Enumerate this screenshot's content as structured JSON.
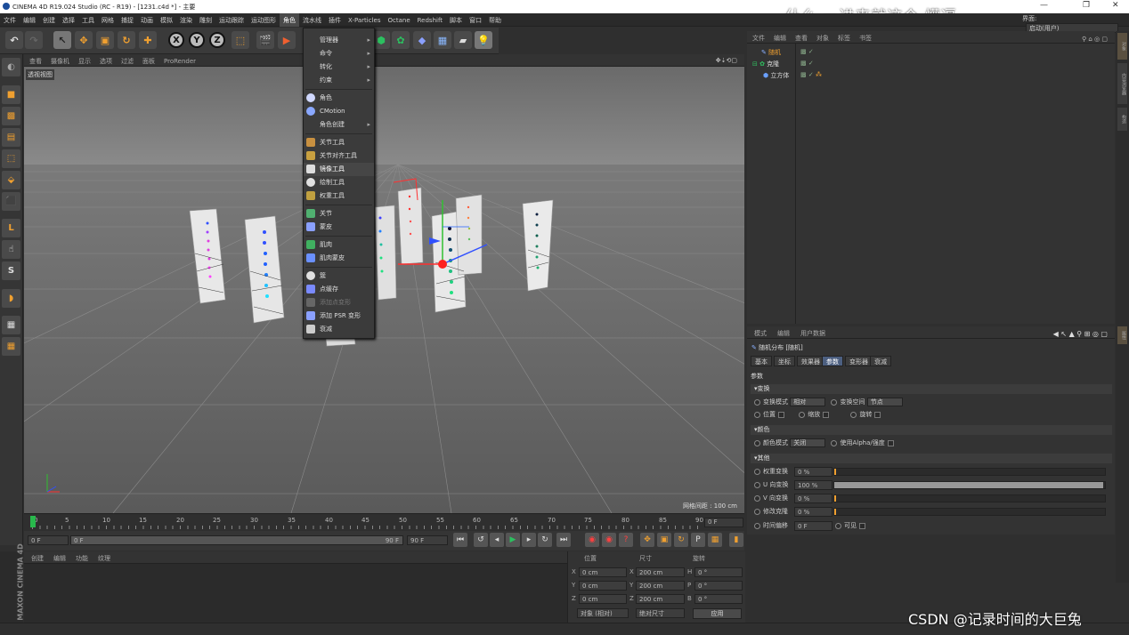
{
  "window": {
    "title": "CINEMA 4D R19.024 Studio (RC - R19) - [1231.c4d *] - 主要",
    "minimize": "—",
    "maximize": "❐",
    "close": "✕"
  },
  "overlay_text": "什么   一进来就这个  懵逼",
  "watermark": "CSDN @记录时间的大巨兔",
  "layout": {
    "label": "界面:",
    "value": "启动(用户)"
  },
  "menubar": [
    "文件",
    "编辑",
    "创建",
    "选择",
    "工具",
    "网格",
    "捕捉",
    "动画",
    "模拟",
    "渲染",
    "雕刻",
    "运动跟踪",
    "运动图形",
    "角色",
    "流水线",
    "插件",
    "X-Particles",
    "Octane",
    "Redshift",
    "脚本",
    "窗口",
    "帮助"
  ],
  "active_menu": "角色",
  "dropdown": {
    "items": [
      {
        "label": "管理器",
        "submenu": true
      },
      {
        "label": "命令",
        "submenu": true
      },
      {
        "label": "转化",
        "submenu": true
      },
      {
        "label": "约束",
        "submenu": true
      },
      {
        "label": "角色"
      },
      {
        "label": "CMotion"
      },
      {
        "label": "角色创建",
        "submenu": true
      },
      {
        "label": "关节工具"
      },
      {
        "label": "关节对齐工具"
      },
      {
        "label": "镜像工具"
      },
      {
        "label": "绘制工具"
      },
      {
        "label": "权重工具"
      },
      {
        "label": "关节"
      },
      {
        "label": "蒙皮"
      },
      {
        "label": "肌肉"
      },
      {
        "label": "肌肉蒙皮"
      },
      {
        "label": "簇"
      },
      {
        "label": "点缓存"
      },
      {
        "label": "添加点变形"
      },
      {
        "label": "添加 PSR 变形"
      },
      {
        "label": "衰减"
      }
    ]
  },
  "viewport": {
    "menu": [
      "查看",
      "摄像机",
      "显示",
      "选项",
      "过滤",
      "面板",
      "ProRender"
    ],
    "label": "透视视图",
    "grid_spacing": "网格间距 : 100 cm"
  },
  "timeline": {
    "ticks": [
      "0",
      "5",
      "10",
      "15",
      "20",
      "25",
      "30",
      "35",
      "40",
      "45",
      "50",
      "55",
      "60",
      "65",
      "70",
      "75",
      "80",
      "85",
      "90"
    ],
    "current_frame": "0 F",
    "start": "0 F",
    "range_start": "0 F",
    "range_end": "90 F",
    "end": "90 F"
  },
  "material": {
    "menu": [
      "创建",
      "编辑",
      "功能",
      "纹理"
    ]
  },
  "maxon": "MAXON CINEMA 4D",
  "coords": {
    "headers": [
      "位置",
      "尺寸",
      "旋转"
    ],
    "rows": [
      {
        "axis": "X",
        "pos": "0 cm",
        "size_axis": "X",
        "size": "200 cm",
        "rot_axis": "H",
        "rot": "0 °"
      },
      {
        "axis": "Y",
        "pos": "0 cm",
        "size_axis": "Y",
        "size": "200 cm",
        "rot_axis": "P",
        "rot": "0 °"
      },
      {
        "axis": "Z",
        "pos": "0 cm",
        "size_axis": "Z",
        "size": "200 cm",
        "rot_axis": "B",
        "rot": "0 °"
      }
    ],
    "mode1": "对象 (相对)",
    "mode2": "绝对尺寸",
    "apply": "应用"
  },
  "objects": {
    "menu": [
      "文件",
      "编辑",
      "查看",
      "对象",
      "标签",
      "书签"
    ],
    "tree": [
      {
        "name": "随机",
        "highlight": true
      },
      {
        "name": "克隆",
        "highlight": false
      },
      {
        "name": "立方体",
        "highlight": false
      }
    ]
  },
  "right_strip": [
    "对象",
    "内容浏览器",
    "构造",
    "属性"
  ],
  "attributes": {
    "menu": [
      "模式",
      "编辑",
      "用户数据"
    ],
    "header": "随机分布 [随机]",
    "tabs": [
      "基本",
      "坐标",
      "效果器",
      "参数",
      "变形器",
      "衰减"
    ],
    "active_tab": "参数",
    "section_title": "参数",
    "transform": {
      "title": "变换",
      "mode_label": "变换模式",
      "mode_value": "相对",
      "space_label": "变换空间",
      "space_value": "节点",
      "position": "位置",
      "scale": "缩放",
      "rotation": "旋转"
    },
    "color": {
      "title": "颜色",
      "mode_label": "颜色模式",
      "mode_value": "关闭",
      "alpha_label": "使用Alpha/强度"
    },
    "other": {
      "title": "其他",
      "rows": [
        {
          "label": "权重变换",
          "value": "0 %",
          "fill": 0
        },
        {
          "label": "U 向变换",
          "value": "100 %",
          "fill": 1.0
        },
        {
          "label": "V 向变换",
          "value": "0 %",
          "fill": 0
        },
        {
          "label": "修改克隆",
          "value": "0 %",
          "fill": 0
        }
      ],
      "time_label": "时间偏移",
      "time_value": "0 F",
      "visible_label": "可见"
    }
  }
}
